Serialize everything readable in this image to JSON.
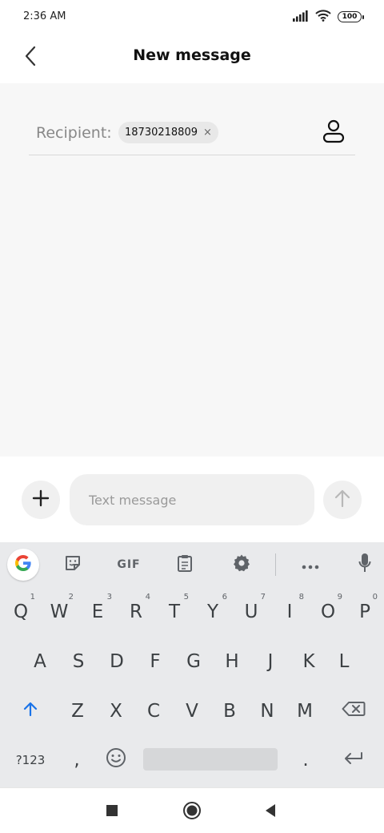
{
  "status_bar": {
    "time": "2:36 AM",
    "battery": "100"
  },
  "header": {
    "title": "New message"
  },
  "recipient": {
    "label": "Recipient:",
    "chip_number": "18730218809",
    "chip_remove": "×"
  },
  "composer": {
    "placeholder": "Text message"
  },
  "keyboard": {
    "toolbar": {
      "gif": "GIF"
    },
    "row1": [
      {
        "key": "Q",
        "hint": "1"
      },
      {
        "key": "W",
        "hint": "2"
      },
      {
        "key": "E",
        "hint": "3"
      },
      {
        "key": "R",
        "hint": "4"
      },
      {
        "key": "T",
        "hint": "5"
      },
      {
        "key": "Y",
        "hint": "6"
      },
      {
        "key": "U",
        "hint": "7"
      },
      {
        "key": "I",
        "hint": "8"
      },
      {
        "key": "O",
        "hint": "9"
      },
      {
        "key": "P",
        "hint": "0"
      }
    ],
    "row2": [
      "A",
      "S",
      "D",
      "F",
      "G",
      "H",
      "J",
      "K",
      "L"
    ],
    "row3": [
      "Z",
      "X",
      "C",
      "V",
      "B",
      "N",
      "M"
    ],
    "row4": {
      "symbols": "?123",
      "comma": ",",
      "period": "."
    }
  },
  "colors": {
    "accent": "#1a73e8",
    "compose_bg": "#f7f7f7",
    "keyboard_bg": "#e9eaec"
  },
  "icons": [
    "back-icon",
    "signal-icon",
    "wifi-icon",
    "battery-icon",
    "contact-icon",
    "plus-icon",
    "send-arrow-icon",
    "google-icon",
    "sticker-icon",
    "clipboard-icon",
    "gear-icon",
    "more-icon",
    "mic-icon",
    "shift-icon",
    "backspace-icon",
    "emoji-icon",
    "enter-icon",
    "recent-apps-icon",
    "home-icon",
    "back-triangle-icon"
  ]
}
